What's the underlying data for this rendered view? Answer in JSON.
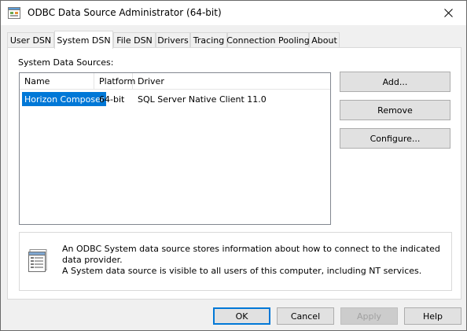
{
  "window": {
    "title": "ODBC Data Source Administrator (64-bit)",
    "close_glyph": "✕",
    "app_icon": "odbc-icon",
    "accent_color": "#0078d7"
  },
  "tabs": [
    {
      "label": "User DSN",
      "active": false
    },
    {
      "label": "System DSN",
      "active": true
    },
    {
      "label": "File DSN",
      "active": false
    },
    {
      "label": "Drivers",
      "active": false
    },
    {
      "label": "Tracing",
      "active": false
    },
    {
      "label": "Connection Pooling",
      "active": false
    },
    {
      "label": "About",
      "active": false
    }
  ],
  "system_dsn": {
    "section_label": "System Data Sources:",
    "columns": [
      "Name",
      "Platform",
      "Driver"
    ],
    "rows": [
      {
        "name": "Horizon Composer",
        "platform": "64-bit",
        "driver": "SQL Server Native Client 11.0",
        "selected": true
      }
    ],
    "buttons": {
      "add": "Add...",
      "remove": "Remove",
      "configure": "Configure..."
    },
    "info_icon": "data-source-info-icon",
    "description_line1": "An ODBC System data source stores information about how to connect to the indicated data provider.",
    "description_line2": "A System data source is visible to all users of this computer, including NT services."
  },
  "footer": {
    "ok": "OK",
    "cancel": "Cancel",
    "apply": "Apply",
    "apply_enabled": false,
    "help": "Help"
  }
}
